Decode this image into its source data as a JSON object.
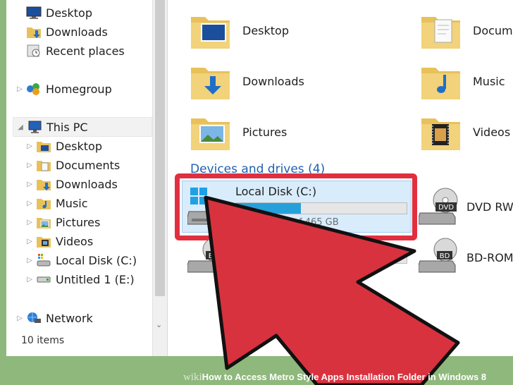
{
  "nav": {
    "items": [
      {
        "label": "Desktop"
      },
      {
        "label": "Downloads"
      },
      {
        "label": "Recent places"
      },
      {
        "label": "Homegroup"
      },
      {
        "label": "This PC"
      },
      {
        "label": "Desktop"
      },
      {
        "label": "Documents"
      },
      {
        "label": "Downloads"
      },
      {
        "label": "Music"
      },
      {
        "label": "Pictures"
      },
      {
        "label": "Videos"
      },
      {
        "label": "Local Disk (C:)"
      },
      {
        "label": "Untitled 1 (E:)"
      },
      {
        "label": "Network"
      }
    ]
  },
  "status": {
    "items_count": "10 items"
  },
  "folders": [
    {
      "label": "Desktop"
    },
    {
      "label": "Documen"
    },
    {
      "label": "Downloads"
    },
    {
      "label": "Music"
    },
    {
      "label": "Pictures"
    },
    {
      "label": "Videos"
    }
  ],
  "devices": {
    "header": "Devices and drives (4)",
    "drives": [
      {
        "label": "Local Disk (C:)",
        "free_text": "f 465 GB",
        "used_fraction": 0.38
      },
      {
        "label": "DVD RW D"
      },
      {
        "label": "BD-ROM D"
      }
    ]
  },
  "icons": {
    "folder": "folder-icon",
    "drive": "hard-drive-icon",
    "dvd": "dvd-drive-icon",
    "bd": "bd-drive-icon",
    "network": "network-icon",
    "homegroup": "homegroup-icon",
    "pc": "computer-icon",
    "arrow": "red-pointer-arrow"
  },
  "colors": {
    "highlight": "#e03040",
    "accent": "#26a0da",
    "frame": "#8fb87c"
  },
  "watermark": {
    "brand": "wiki",
    "title": "How to Access Metro Style Apps Installation Folder in Windows 8"
  }
}
